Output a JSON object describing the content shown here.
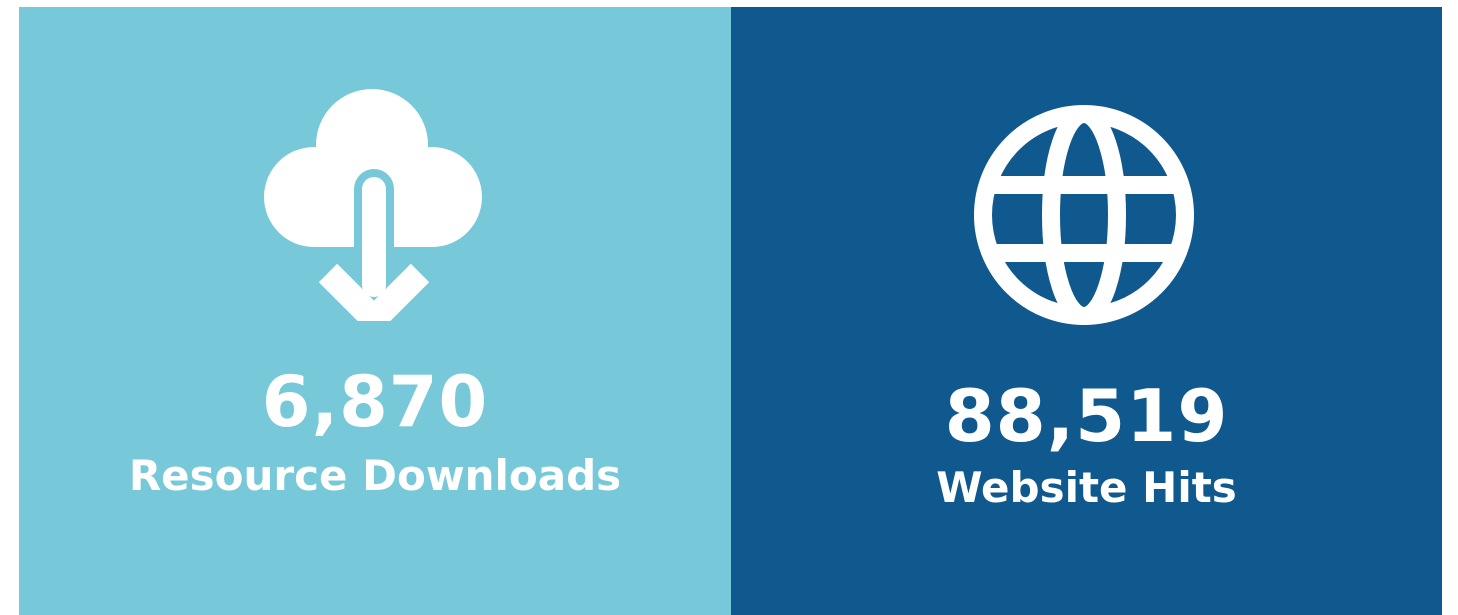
{
  "colors": {
    "left_panel_bg": "#77c8d8",
    "right_panel_bg": "#10598e",
    "text": "#ffffff"
  },
  "stats": [
    {
      "icon": "cloud-download-icon",
      "number": "6,870",
      "label": "Resource Downloads"
    },
    {
      "icon": "globe-icon",
      "number": "88,519",
      "label": "Website Hits"
    }
  ]
}
